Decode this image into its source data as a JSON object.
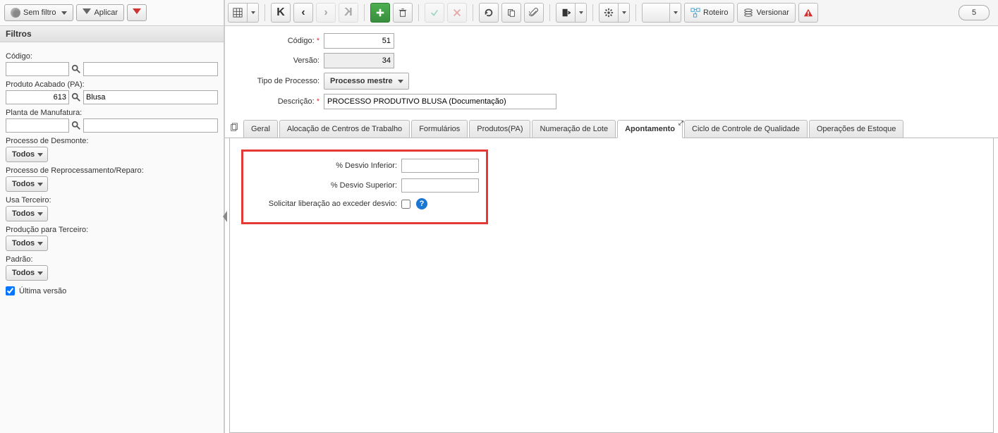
{
  "sidebar": {
    "filter_dropdown": "Sem filtro",
    "apply_button": "Aplicar",
    "header": "Filtros",
    "codigo_label": "Código:",
    "codigo_value": "",
    "pa_label": "Produto Acabado (PA):",
    "pa_code": "613",
    "pa_desc": "Blusa",
    "planta_label": "Planta de Manufatura:",
    "planta_code": "",
    "planta_desc": "",
    "desmonte_label": "Processo de Desmonte:",
    "desmonte_value": "Todos",
    "reparo_label": "Processo de Reprocessamento/Reparo:",
    "reparo_value": "Todos",
    "terceiro_label": "Usa Terceiro:",
    "terceiro_value": "Todos",
    "prod_terceiro_label": "Produção para Terceiro:",
    "prod_terceiro_value": "Todos",
    "padrao_label": "Padrão:",
    "padrao_value": "Todos",
    "ultima_versao_label": "Última versão"
  },
  "toolbar": {
    "roteiro": "Roteiro",
    "versionar": "Versionar",
    "counter": "5"
  },
  "form": {
    "codigo_label": "Código:",
    "codigo_value": "51",
    "versao_label": "Versão:",
    "versao_value": "34",
    "tipo_label": "Tipo de Processo:",
    "tipo_value": "Processo mestre",
    "descricao_label": "Descrição:",
    "descricao_value": "PROCESSO PRODUTIVO BLUSA (Documentação)"
  },
  "tabs": {
    "geral": "Geral",
    "alocacao": "Alocação de Centros de Trabalho",
    "formularios": "Formulários",
    "produtos": "Produtos(PA)",
    "numeracao": "Numeração de Lote",
    "apontamento": "Apontamento",
    "qualidade": "Ciclo de Controle de Qualidade",
    "estoque": "Operações de Estoque"
  },
  "apontamento": {
    "desvio_inf_label": "% Desvio Inferior:",
    "desvio_inf_value": "",
    "desvio_sup_label": "% Desvio Superior:",
    "desvio_sup_value": "",
    "solicitar_label": "Solicitar liberação ao exceder desvio:"
  }
}
